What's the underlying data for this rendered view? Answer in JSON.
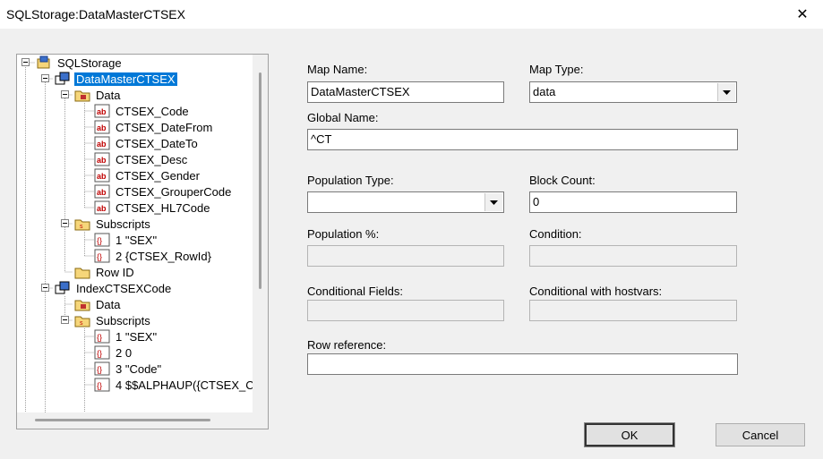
{
  "window": {
    "title": "SQLStorage:DataMasterCTSEX",
    "close_glyph": "✕"
  },
  "tree": {
    "root": "SQLStorage",
    "nodes": [
      {
        "label": "DataMasterCTSEX",
        "icon": "map-icon"
      },
      {
        "label": "Data",
        "icon": "folder-data-icon"
      },
      {
        "label": "CTSEX_Code",
        "icon": "field-ab-icon"
      },
      {
        "label": "CTSEX_DateFrom",
        "icon": "field-ab-icon"
      },
      {
        "label": "CTSEX_DateTo",
        "icon": "field-ab-icon"
      },
      {
        "label": "CTSEX_Desc",
        "icon": "field-ab-icon"
      },
      {
        "label": "CTSEX_Gender",
        "icon": "field-ab-icon"
      },
      {
        "label": "CTSEX_GrouperCode",
        "icon": "field-ab-icon"
      },
      {
        "label": "CTSEX_HL7Code",
        "icon": "field-ab-icon"
      },
      {
        "label": "Subscripts",
        "icon": "folder-subscripts-icon"
      },
      {
        "label": "1 \"SEX\"",
        "icon": "subscript-icon"
      },
      {
        "label": "2 {CTSEX_RowId}",
        "icon": "subscript-icon"
      },
      {
        "label": "Row ID",
        "icon": "folder-rowid-icon"
      },
      {
        "label": "IndexCTSEXCode",
        "icon": "map-icon"
      },
      {
        "label": "Data",
        "icon": "folder-data-icon"
      },
      {
        "label": "Subscripts",
        "icon": "folder-subscripts-icon"
      },
      {
        "label": "1 \"SEX\"",
        "icon": "subscript-icon"
      },
      {
        "label": "2 0",
        "icon": "subscript-icon"
      },
      {
        "label": "3 \"Code\"",
        "icon": "subscript-icon"
      },
      {
        "label": "4 $$ALPHAUP({CTSEX_C",
        "icon": "subscript-icon"
      }
    ]
  },
  "form": {
    "map_name_label": "Map Name:",
    "map_name_value": "DataMasterCTSEX",
    "map_type_label": "Map Type:",
    "map_type_value": "data",
    "global_name_label": "Global Name:",
    "global_name_value": "^CT",
    "population_type_label": "Population Type:",
    "population_type_value": "",
    "block_count_label": "Block Count:",
    "block_count_value": "0",
    "population_pct_label": "Population %:",
    "population_pct_value": "",
    "condition_label": "Condition:",
    "condition_value": "",
    "conditional_fields_label": "Conditional Fields:",
    "conditional_fields_value": "",
    "conditional_hostvars_label": "Conditional with hostvars:",
    "conditional_hostvars_value": "",
    "row_reference_label": "Row reference:",
    "row_reference_value": ""
  },
  "buttons": {
    "ok": "OK",
    "cancel": "Cancel"
  },
  "colors": {
    "selection": "#0078d7",
    "dialog_bg": "#f0f0f0"
  }
}
